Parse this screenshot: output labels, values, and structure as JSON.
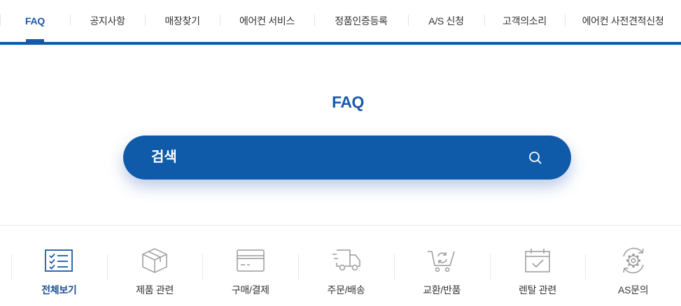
{
  "nav": {
    "items": [
      {
        "label": "FAQ",
        "active": true
      },
      {
        "label": "공지사항"
      },
      {
        "label": "매장찾기"
      },
      {
        "label": "에어컨 서비스"
      },
      {
        "label": "정품인증등록"
      },
      {
        "label": "A/S 신청"
      },
      {
        "label": "고객의소리"
      },
      {
        "label": "에어컨 사전견적신청"
      }
    ]
  },
  "page": {
    "title": "FAQ"
  },
  "search": {
    "placeholder": "검색",
    "icon": "search-icon"
  },
  "categories": [
    {
      "label": "전체보기",
      "icon": "checklist-icon",
      "active": true
    },
    {
      "label": "제품 관련",
      "icon": "box-icon"
    },
    {
      "label": "구매/결제",
      "icon": "card-icon"
    },
    {
      "label": "주문/배송",
      "icon": "truck-icon"
    },
    {
      "label": "교환/반품",
      "icon": "cart-exchange-icon"
    },
    {
      "label": "렌탈 관련",
      "icon": "calendar-check-icon"
    },
    {
      "label": "AS문의",
      "icon": "gear-icon"
    }
  ],
  "colors": {
    "brand": "#0f5ba9",
    "active_text": "#1a5aa8",
    "icon_gray": "#9a9a9a"
  }
}
